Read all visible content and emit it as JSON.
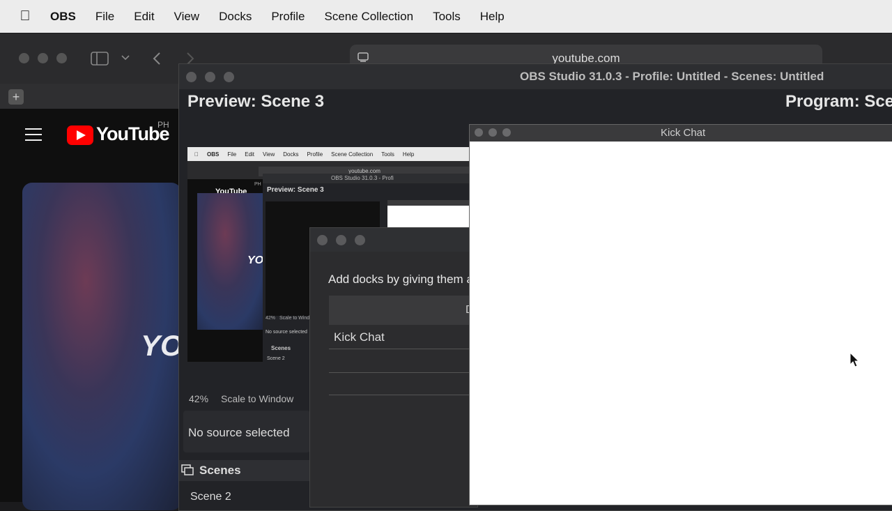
{
  "menubar": {
    "app_name": "OBS",
    "items": [
      "File",
      "Edit",
      "View",
      "Docks",
      "Profile",
      "Scene Collection",
      "Tools",
      "Help"
    ]
  },
  "safari": {
    "address": "youtube.com",
    "youtube": {
      "logo_text": "YouTube",
      "region": "PH",
      "video_text": "YOU"
    }
  },
  "obs": {
    "title": "OBS Studio 31.0.3 - Profile: Untitled - Scenes: Untitled",
    "preview_label": "Preview: Scene 3",
    "program_label": "Program: Sce",
    "zoom": "42%",
    "scale_mode": "Scale to Window",
    "source_status": "No source selected",
    "scenes_header": "Scenes",
    "scene_item": "Scene 2"
  },
  "mini": {
    "menu": [
      "OBS",
      "File",
      "Edit",
      "View",
      "Docks",
      "Profile",
      "Scene Collection",
      "Tools",
      "Help"
    ],
    "address": "youtube.com",
    "obs_title": "OBS Studio 31.0.3 - Profi",
    "preview_label": "Preview: Scene 3",
    "youtube": "YouTube",
    "region": "PH",
    "video_text": "YOU",
    "zoom": "42%",
    "scale": "Scale to Window",
    "source": "No source selected",
    "scenes": "Scenes",
    "scene": "Scene 2"
  },
  "docks_dialog": {
    "description": "Add docks by giving them a",
    "header_partial": "D",
    "rows": [
      "Kick Chat",
      "",
      ""
    ]
  },
  "kick": {
    "title": "Kick Chat"
  }
}
